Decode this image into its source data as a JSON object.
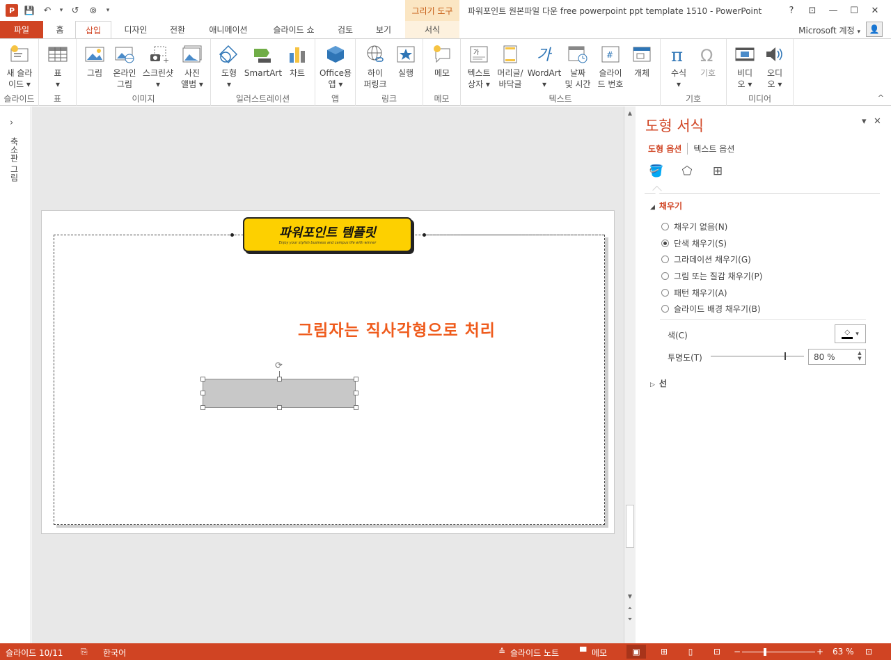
{
  "titlebar": {
    "context_tab_header": "그리기 도구",
    "window_title": "파워포인트 원본파일 다운 free powerpoint ppt template 1510 - PowerPoint",
    "help": "?",
    "ribbon_display": "⊡",
    "minimize": "—",
    "maximize": "☐",
    "close": "✕"
  },
  "qat": {
    "logo": "P",
    "save": "💾",
    "undo": "↶",
    "dropdown": "▾",
    "redo": "↺",
    "present": "⊚",
    "customize": "▾"
  },
  "tabs": [
    {
      "label": "파일"
    },
    {
      "label": "홈"
    },
    {
      "label": "삽입"
    },
    {
      "label": "디자인"
    },
    {
      "label": "전환"
    },
    {
      "label": "애니메이션"
    },
    {
      "label": "슬라이드 쇼"
    },
    {
      "label": "검토"
    },
    {
      "label": "보기"
    },
    {
      "label": "서식"
    }
  ],
  "account": {
    "label": "Microsoft 계정",
    "chevron": "▾",
    "avatar": "👤"
  },
  "ribbon": {
    "groups": {
      "slides": "슬라이드",
      "table": "표",
      "images": "이미지",
      "illustrations": "일러스트레이션",
      "apps": "앱",
      "links": "링크",
      "comments": "메모",
      "text": "텍스트",
      "symbols": "기호",
      "media": "미디어"
    },
    "buttons": {
      "new_slide_1": "새 슬라",
      "new_slide_2": "이드 ▾",
      "table_1": "표",
      "table_2": "▾",
      "picture": "그림",
      "online_picture_1": "온라인",
      "online_picture_2": "그림",
      "screenshot_1": "스크린샷",
      "screenshot_2": "▾",
      "photo_album_1": "사진",
      "photo_album_2": "앨범 ▾",
      "shapes_1": "도형",
      "shapes_2": "▾",
      "smartart": "SmartArt",
      "chart": "차트",
      "office_apps_1": "Office용",
      "office_apps_2": "앱 ▾",
      "hyperlink_1": "하이",
      "hyperlink_2": "퍼링크",
      "action": "실행",
      "comment": "메모",
      "textbox_1": "텍스트",
      "textbox_2": "상자 ▾",
      "header_footer_1": "머리글/",
      "header_footer_2": "바닥글",
      "wordart_1": "WordArt",
      "wordart_2": "▾",
      "datetime_1": "날짜",
      "datetime_2": "및 시간",
      "slide_number_1": "슬라이",
      "slide_number_2": "드 번호",
      "object": "개체",
      "equation_1": "수식",
      "equation_2": "▾",
      "symbol": "기호",
      "video_1": "비디",
      "video_2": "오 ▾",
      "audio_1": "오디",
      "audio_2": "오 ▾"
    },
    "collapse": "^"
  },
  "left_pane": {
    "expand": "›",
    "label": "축소판 그림"
  },
  "slide": {
    "banner_title": "파워포인트 템플릿",
    "banner_subtitle": "Enjoy your stylish business and campus life with winner",
    "caption": "그림자는 직사각형으로 처리",
    "rotate": "⟳"
  },
  "scrollbar": {
    "up": "▲",
    "down": "▼",
    "prev": "⏶",
    "next": "⏷"
  },
  "format_pane": {
    "title": "도형 서식",
    "options_menu": "▾",
    "close": "✕",
    "tab_shape_options": "도형 옵션",
    "tab_text_options": "텍스트 옵션",
    "icon_fill": "🪣",
    "icon_effects": "⬠",
    "icon_size": "⊞",
    "fill_section": {
      "toggle": "◢",
      "label": "채우기"
    },
    "fill_options": [
      "채우기 없음(N)",
      "단색 채우기(S)",
      "그라데이션 채우기(G)",
      "그림 또는 질감 채우기(P)",
      "패턴 채우기(A)",
      "슬라이드 배경 채우기(B)"
    ],
    "selected_fill_index": 1,
    "color_label": "색(C)",
    "color_icon": "◇",
    "color_dropdown": "▾",
    "transparency_label": "투명도(T)",
    "transparency_value": "80 %",
    "transparency_level": 0.8,
    "spin_arrows": "▲▼",
    "line_section": {
      "toggle": "▷",
      "label": "선"
    },
    "accent_color": "#d04423"
  },
  "statusbar": {
    "slide_info": "슬라이드 10/11",
    "spell_icon": "⎘",
    "language": "한국어",
    "notes_icon": "≙",
    "notes": "슬라이드 노트",
    "comments_icon": "▀",
    "comments": "메모",
    "view_normal": "▣",
    "view_sorter": "⊞",
    "view_reading": "▯",
    "view_slideshow": "⊡",
    "zoom_out": "−",
    "zoom_in": "+",
    "zoom": "63 %",
    "fit": "⊡"
  }
}
